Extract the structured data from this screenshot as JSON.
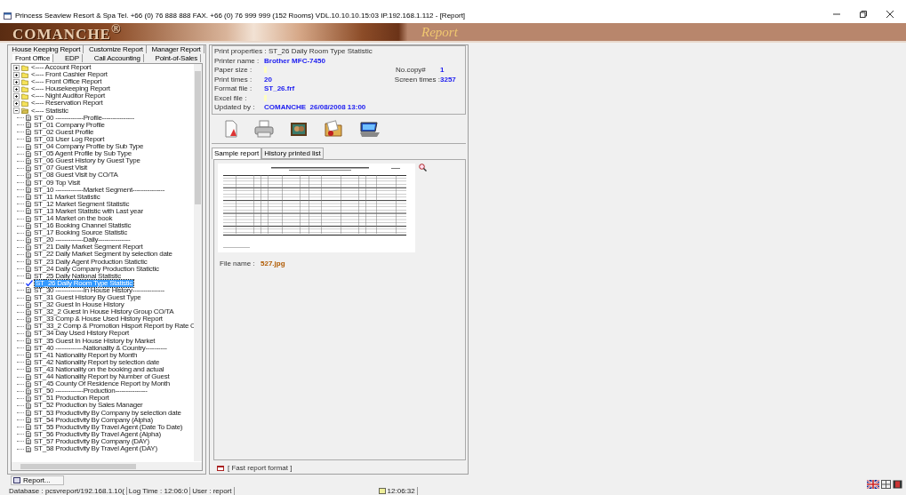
{
  "window": {
    "title": "Princess Seaview Resort & Spa Tel. +66 (0) 76 888 888 FAX. +66 (0) 76 999 999 (152 Rooms) VDL.10.10.10.15:03 IP.192.168.1.112 - [Report]"
  },
  "header": {
    "logo": "COMANCHE$^{®}$",
    "module": "Report"
  },
  "report_tabs": [
    [
      {
        "label": "House Keeping Report",
        "selected": false
      },
      {
        "label": "Customize Report",
        "selected": false
      },
      {
        "label": "Manager Report",
        "selected": false
      }
    ],
    [
      {
        "label": "Front Office",
        "selected": true
      },
      {
        "label": "EDP",
        "selected": false
      },
      {
        "label": "Call Accounting",
        "selected": false
      },
      {
        "label": "Point-of-Sales",
        "selected": false
      }
    ]
  ],
  "tree": [
    {
      "label": "<---- Account Report",
      "expanded": false,
      "selected": false
    },
    {
      "label": "<---- Front Cashier Report",
      "expanded": false,
      "selected": false
    },
    {
      "label": "<---- Front Office Report",
      "expanded": false,
      "selected": false
    },
    {
      "label": "<---- Housekeeping Report",
      "expanded": false,
      "selected": false
    },
    {
      "label": "<---- Night Auditor Report",
      "expanded": false,
      "selected": false
    },
    {
      "label": "<---- Reservation Report",
      "expanded": false,
      "selected": false
    },
    {
      "label": "<---- Statistic",
      "expanded": true,
      "selected": false,
      "children": [
        {
          "label": "ST_00 -------------Profile---------------",
          "selected": false
        },
        {
          "label": "ST_01 Company Profile",
          "selected": false
        },
        {
          "label": "ST_02 Guest Profile",
          "selected": false
        },
        {
          "label": "ST_03 User Log Report",
          "selected": false
        },
        {
          "label": "ST_04 Company Profile by Sub Type",
          "selected": false
        },
        {
          "label": "ST_05 Agent Profile by Sub Type",
          "selected": false
        },
        {
          "label": "ST_06 Guest History by Guest Type",
          "selected": false
        },
        {
          "label": "ST_07 Guest Visit",
          "selected": false
        },
        {
          "label": "ST_08 Guest Visit by CO/TA",
          "selected": false
        },
        {
          "label": "ST_09 Top Visit",
          "selected": false
        },
        {
          "label": "ST_10 -------------Market Segment---------------",
          "selected": false
        },
        {
          "label": "ST_11 Market Statistic",
          "selected": false
        },
        {
          "label": "ST_12 Market Segment Statistic",
          "selected": false
        },
        {
          "label": "ST_13 Market Statistic with Last year",
          "selected": false
        },
        {
          "label": "ST_14 Market on the book",
          "selected": false
        },
        {
          "label": "ST_16 Booking Channel Statistic",
          "selected": false
        },
        {
          "label": "ST_17 Booking Source Statistic",
          "selected": false
        },
        {
          "label": "ST_20 -------------Daily---------------",
          "selected": false
        },
        {
          "label": "ST_21 Daily Market Segment Report",
          "selected": false
        },
        {
          "label": "ST_22 Daily Market Segment by selection date",
          "selected": false
        },
        {
          "label": "ST_23 Daily Agent Production Statictic",
          "selected": false
        },
        {
          "label": "ST_24 Daily Company Production Statictic",
          "selected": false
        },
        {
          "label": "ST_25 Daily National Statistic",
          "selected": false
        },
        {
          "label": "ST_26 Daily Room Type Statistic",
          "selected": true
        },
        {
          "label": "ST_30 -------------In House History---------------",
          "selected": false
        },
        {
          "label": "ST_31 Guest History By Guest Type",
          "selected": false
        },
        {
          "label": "ST_32 Guest In House History",
          "selected": false
        },
        {
          "label": "ST_32_2 Guest In House History Group CO/TA",
          "selected": false
        },
        {
          "label": "ST_33 Comp & House Used History Report",
          "selected": false
        },
        {
          "label": "ST_33_2 Comp & Promotion Hisport Report by Rate C",
          "selected": false
        },
        {
          "label": "ST_34 Day Used History Report",
          "selected": false
        },
        {
          "label": "ST_35 Guest In House History by Market",
          "selected": false
        },
        {
          "label": "ST_40 -------------Nationality & Country----------",
          "selected": false
        },
        {
          "label": "ST_41 Nationality Report by Month",
          "selected": false
        },
        {
          "label": "ST_42 Nationality Report by selection date",
          "selected": false
        },
        {
          "label": "ST_43 Nationality on the booking and actual",
          "selected": false
        },
        {
          "label": "ST_44 Nationality Report by Number of Guest",
          "selected": false
        },
        {
          "label": "ST_45 County Of Residence Report by Month",
          "selected": false
        },
        {
          "label": "ST_50 -------------Production---------------",
          "selected": false
        },
        {
          "label": "ST_51 Production Report",
          "selected": false
        },
        {
          "label": "ST_52 Production by Sales Manager",
          "selected": false
        },
        {
          "label": "ST_53 Productivity By Company by selection date",
          "selected": false
        },
        {
          "label": "ST_54 Productivity By Company (Alpha)",
          "selected": false
        },
        {
          "label": "ST_55 Productivity By Travel Agent (Date To Date)",
          "selected": false
        },
        {
          "label": "ST_56 Productivity By Travel Agent (Alpha)",
          "selected": false
        },
        {
          "label": "ST_57 Productivity By Company (DAY)",
          "selected": false
        },
        {
          "label": "ST_58 Productivity By Travel Agent (DAY)",
          "selected": false
        }
      ]
    }
  ],
  "print_properties": {
    "title": "Print properties : ST_26 Daily Room Type Statistic",
    "printer_name": {
      "label": "Printer name :",
      "value": "Brother MFC-7450"
    },
    "paper_size": {
      "label": "Paper size :"
    },
    "no_copy": {
      "label": "No.copy#",
      "value": "1"
    },
    "print_times": {
      "label": "Print times :",
      "value": "20"
    },
    "screen_times": {
      "label": "Screen times :",
      "value": "3257"
    },
    "format_file": {
      "label": "Format file :",
      "value": "ST_26.frf"
    },
    "excel_file": {
      "label": "Excel file :"
    },
    "updated_by": {
      "label": "Updated by :",
      "value": "COMANCHE  26/08/2008 13:00"
    }
  },
  "preview_tabs": [
    {
      "label": "Sample report",
      "selected": true
    },
    {
      "label": "History printed list",
      "selected": false
    }
  ],
  "file_name": {
    "label": "File name :",
    "value": "527.jpg"
  },
  "format_note": "[ Fast report format ]",
  "taskbar": {
    "label": "Report..."
  },
  "status_bar": [
    "Database : pcsvreport/192.168.1.10(",
    "Log Time : 12:06:0",
    "User : report",
    "12:06:32"
  ]
}
